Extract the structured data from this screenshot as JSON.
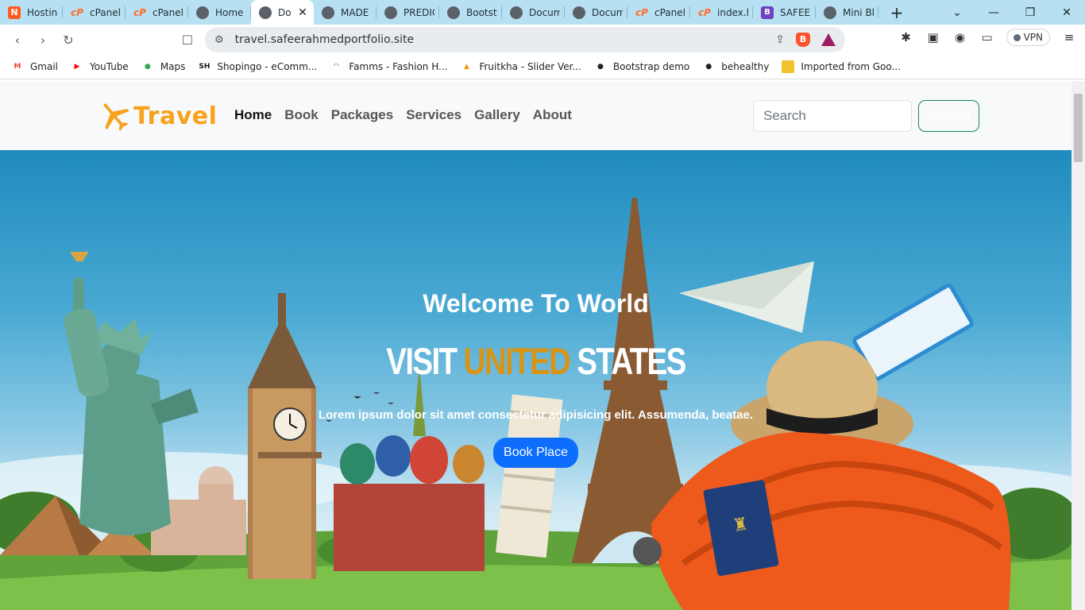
{
  "browser": {
    "tabs": [
      {
        "label": "Hosting",
        "icon": "hosting-icon",
        "glyph": "N",
        "cls": "icon-hosting"
      },
      {
        "label": "cPanel -",
        "icon": "cpanel-icon",
        "glyph": "cP",
        "cls": "icon-cpanel"
      },
      {
        "label": "cPanel -",
        "icon": "cpanel-icon",
        "glyph": "cP",
        "cls": "icon-cpanel"
      },
      {
        "label": "Home",
        "icon": "globe-icon",
        "glyph": "",
        "cls": "icon-globe"
      },
      {
        "label": "Do",
        "icon": "globe-icon",
        "glyph": "",
        "cls": "icon-globe",
        "active": true
      },
      {
        "label": "MADE B",
        "icon": "globe-icon",
        "glyph": "",
        "cls": "icon-globe"
      },
      {
        "label": "PREDIC",
        "icon": "globe-icon",
        "glyph": "",
        "cls": "icon-globe"
      },
      {
        "label": "Bootstra",
        "icon": "globe-icon",
        "glyph": "",
        "cls": "icon-globe"
      },
      {
        "label": "Docum",
        "icon": "globe-icon",
        "glyph": "",
        "cls": "icon-globe"
      },
      {
        "label": "Docum",
        "icon": "globe-icon",
        "glyph": "",
        "cls": "icon-globe"
      },
      {
        "label": "cPanel F",
        "icon": "cpanel-icon",
        "glyph": "cP",
        "cls": "icon-cpanel"
      },
      {
        "label": "index.ht",
        "icon": "cpanel-icon",
        "glyph": "cP",
        "cls": "icon-cpanel"
      },
      {
        "label": "SAFEER",
        "icon": "bootstrap-icon",
        "glyph": "B",
        "cls": "icon-boot"
      },
      {
        "label": "Mini Blo",
        "icon": "globe-icon",
        "glyph": "",
        "cls": "icon-globe"
      }
    ],
    "url": "travel.safeerahmedportfolio.site",
    "vpn_label": "VPN",
    "bookmarks": [
      {
        "label": "Gmail",
        "glyph": "M",
        "color": "#ea4335"
      },
      {
        "label": "YouTube",
        "glyph": "▶",
        "color": "#ff0000"
      },
      {
        "label": "Maps",
        "glyph": "●",
        "color": "#34a853"
      },
      {
        "label": "Shopingo - eComm...",
        "glyph": "SH",
        "color": "#111111"
      },
      {
        "label": "Famms - Fashion H...",
        "glyph": "◠",
        "color": "#c0392b"
      },
      {
        "label": "Fruitkha - Slider Ver...",
        "glyph": "▲",
        "color": "#f39c12"
      },
      {
        "label": "Bootstrap demo",
        "glyph": "●",
        "color": "#222222"
      },
      {
        "label": "behealthy",
        "glyph": "●",
        "color": "#222222"
      },
      {
        "label": "Imported from Goo...",
        "glyph": "",
        "color": "#f2c12e"
      }
    ]
  },
  "site": {
    "logo_text": "Travel",
    "menu": [
      {
        "label": "Home",
        "active": true
      },
      {
        "label": "Book"
      },
      {
        "label": "Packages"
      },
      {
        "label": "Services"
      },
      {
        "label": "Gallery"
      },
      {
        "label": "About"
      }
    ],
    "search_placeholder": "Search",
    "search_button": "Search",
    "hero": {
      "title": "Welcome To World",
      "headline_part1": "VISIT ",
      "headline_part2": "UNITED",
      "headline_part3": " STATES",
      "subtitle": "Lorem ipsum dolor sit amet consectetur adipisicing elit. Assumenda, beatae.",
      "button": "Book Place"
    },
    "colors": {
      "accent": "#f6a21b",
      "primary": "#0d6efd",
      "search_border": "#198754"
    }
  }
}
